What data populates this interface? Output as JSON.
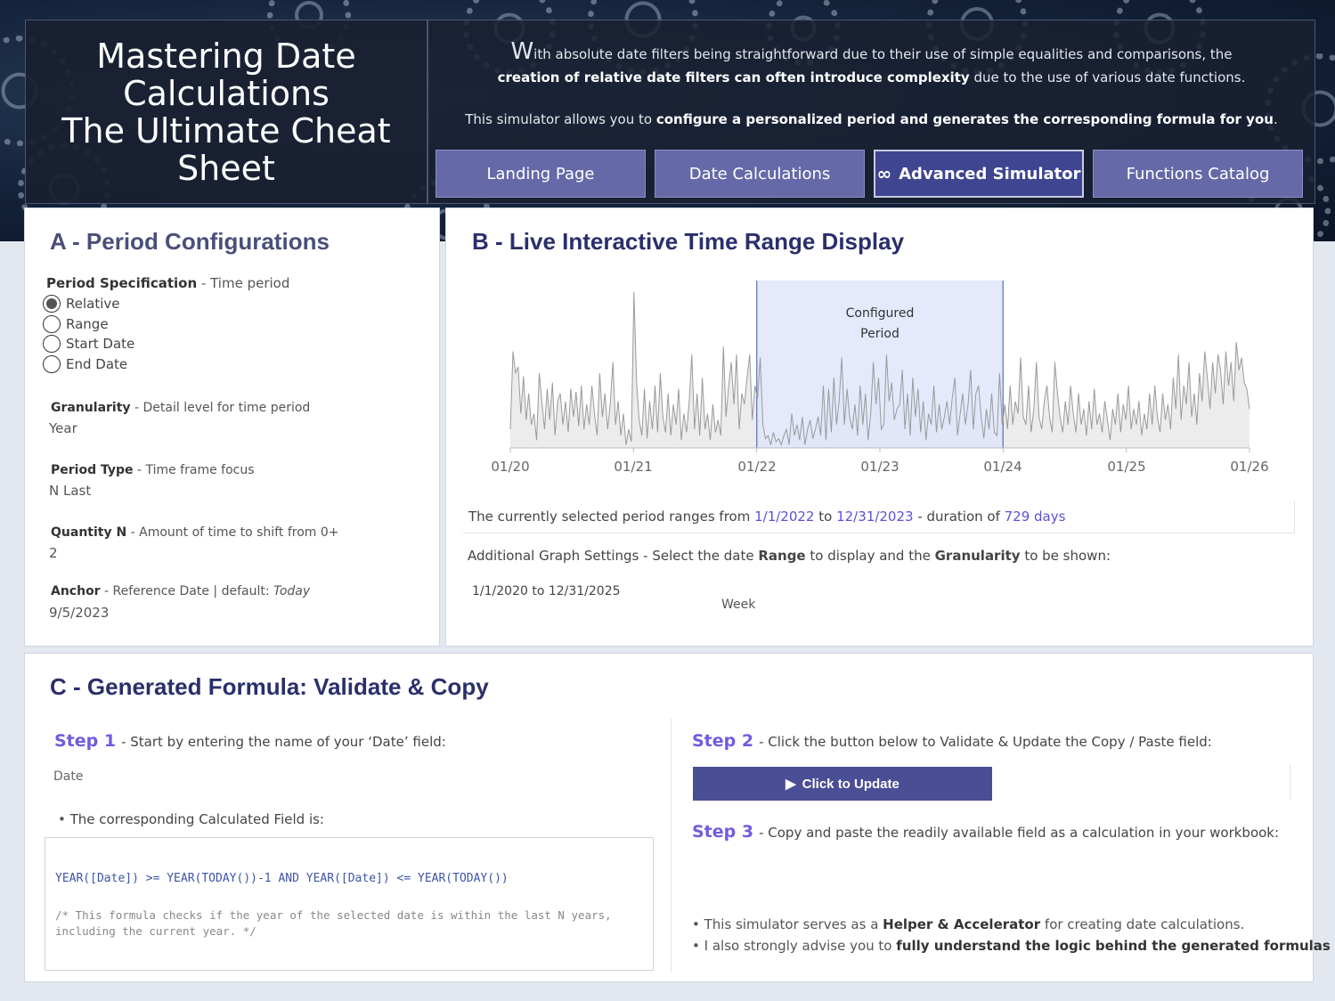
{
  "header": {
    "title": "Mastering Date\nCalculations\nThe Ultimate Cheat\nSheet",
    "intro_first_letter": "W",
    "intro_line1": "ith absolute date filters being straightforward due to their use of simple equalities and comparisons, the",
    "intro_line2_bold": "creation of relative date filters can often introduce complexity",
    "intro_line2_rest": " due to the use of various date functions.",
    "intro_p2_start": "This simulator allows you to ",
    "intro_p2_bold": "configure a personalized period and generates the corresponding formula for you",
    "intro_p2_end": "."
  },
  "nav": [
    {
      "label": "Landing Page",
      "active": false
    },
    {
      "label": "Date Calculations",
      "active": false
    },
    {
      "label": "Advanced Simulator",
      "active": true,
      "icon": "∞"
    },
    {
      "label": "Functions Catalog",
      "active": false
    }
  ],
  "panel_a": {
    "title": "A - Period Configurations",
    "period_spec_label": "Period Specification",
    "period_spec_desc": " - Time period",
    "radio_options": [
      "Relative",
      "Range",
      "Start Date",
      "End Date"
    ],
    "radio_selected": "Relative",
    "granularity_label": "Granularity",
    "granularity_desc": " - Detail level for time period",
    "granularity_value": "Year",
    "period_type_label": "Period Type",
    "period_type_desc": " - Time frame focus",
    "period_type_value": "N Last",
    "quantity_label": "Quantity N",
    "quantity_desc": " - Amount of time to shift from 0+",
    "quantity_value": "2",
    "anchor_label": "Anchor",
    "anchor_desc": " - Reference Date | default: ",
    "anchor_default": "Today",
    "anchor_value": "9/5/2023"
  },
  "panel_b": {
    "title": "B - Live Interactive Time Range Display",
    "highlight_line1": "Configured",
    "highlight_line2": "Period",
    "selected_prefix": "The currently selected period ranges from ",
    "selected_start": "1/1/2022",
    "selected_to": " to ",
    "selected_end": "12/31/2023",
    "duration_prefix": " - duration of ",
    "duration_value": "729 days",
    "settings_prefix": "Additional Graph Settings  -  Select the date ",
    "settings_range_word": "Range",
    "settings_mid": " to display and the ",
    "settings_gran_word": "Granularity",
    "settings_end": " to be shown:",
    "graph_range": "1/1/2020 to 12/31/2025",
    "graph_granularity": "Week"
  },
  "chart_data": {
    "type": "area",
    "x_start": "1/1/2020",
    "x_end": "12/31/2025",
    "granularity": "Week",
    "xticks": [
      "01/20",
      "01/21",
      "01/22",
      "01/23",
      "01/24",
      "01/25",
      "01/26"
    ],
    "highlight_range": [
      "1/1/2022",
      "12/31/2023"
    ],
    "series_color": "#9a9a9a",
    "highlight_color": "#dfe6fb",
    "grid": false,
    "series": [
      {
        "values": [
          12,
          62,
          48,
          52,
          22,
          46,
          18,
          35,
          15,
          22,
          5,
          48,
          30,
          12,
          38,
          18,
          42,
          8,
          30,
          35,
          15,
          30,
          10,
          38,
          20,
          36,
          14,
          40,
          12,
          28,
          15,
          40,
          22,
          8,
          48,
          20,
          35,
          12,
          28,
          55,
          15,
          30,
          8,
          22,
          2,
          12,
          4,
          100,
          42,
          18,
          8,
          38,
          6,
          30,
          12,
          40,
          10,
          48,
          20,
          10,
          35,
          8,
          28,
          15,
          38,
          5,
          22,
          10,
          30,
          60,
          12,
          35,
          8,
          45,
          12,
          22,
          5,
          28,
          10,
          18,
          8,
          65,
          20,
          40,
          55,
          28,
          60,
          12,
          35,
          28,
          45,
          60,
          18,
          40,
          32,
          58,
          15,
          6,
          8,
          2,
          10,
          4,
          6,
          2,
          8,
          12,
          2,
          22,
          8,
          15,
          5,
          20,
          2,
          12,
          18,
          6,
          12,
          20,
          8,
          40,
          5,
          38,
          10,
          45,
          15,
          30,
          58,
          15,
          38,
          20,
          12,
          28,
          8,
          40,
          15,
          35,
          5,
          22,
          55,
          28,
          45,
          12,
          15,
          60,
          30,
          42,
          18,
          25,
          28,
          50,
          12,
          35,
          8,
          45,
          20,
          38,
          10,
          30,
          5,
          22,
          15,
          40,
          10,
          28,
          12,
          20,
          30,
          15,
          32,
          45,
          8,
          22,
          35,
          15,
          28,
          50,
          12,
          35,
          40,
          20,
          6,
          25,
          12,
          35,
          10,
          8,
          48,
          15,
          28,
          12,
          40,
          15,
          30,
          22,
          58,
          20,
          15,
          40,
          10,
          25,
          55,
          20,
          12,
          30,
          40,
          20,
          10,
          55,
          35,
          20,
          10,
          30,
          15,
          40,
          22,
          10,
          35,
          15,
          25,
          8,
          30,
          12,
          38,
          15,
          22,
          10,
          30,
          18,
          5,
          25,
          15,
          35,
          10,
          28,
          18,
          40,
          12,
          25,
          15,
          30,
          8,
          22,
          12,
          35,
          15,
          40,
          20,
          10,
          35,
          18,
          28,
          12,
          45,
          25,
          60,
          18,
          40,
          28,
          55,
          20,
          35,
          15,
          48,
          30,
          62,
          45,
          25,
          55,
          35,
          60,
          50,
          28,
          62,
          40,
          55,
          30,
          68,
          50,
          58,
          42,
          38,
          25
        ]
      }
    ]
  },
  "panel_c": {
    "title": "C - Generated Formula: Validate & Copy",
    "step1_num": "Step 1",
    "step1_text": "-  Start by entering the name of your ‘Date’ field:",
    "date_field_value": "Date",
    "calc_field_label": "The corresponding Calculated Field is:",
    "formula": "YEAR([Date]) >= YEAR(TODAY())-1 AND YEAR([Date]) <= YEAR(TODAY())",
    "formula_comment": "/* This formula checks if the year of the selected date is within the last N years, including the current year. */",
    "step2_num": "Step 2",
    "step2_text": "-  Click the button below to Validate & Update the Copy / Paste field:",
    "update_button": "Click to Update",
    "step3_num": "Step 3",
    "step3_text": "-  Copy and paste the readily available field as a calculation in your workbook:",
    "bullet1_start": "This simulator serves as a ",
    "bullet1_bold": "Helper & Accelerator",
    "bullet1_end": " for creating date calculations.",
    "bullet2_start": "I also strongly advise you to ",
    "bullet2_bold": "fully understand the logic behind the generated formulas"
  }
}
